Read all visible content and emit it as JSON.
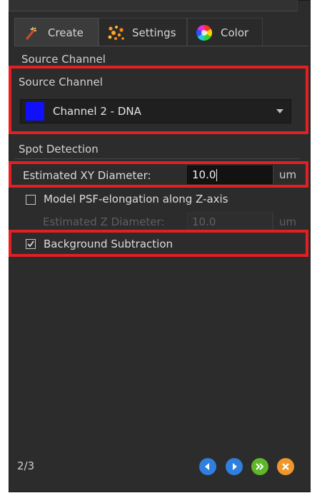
{
  "tabs": [
    {
      "label": "Create",
      "icon": "wand-icon"
    },
    {
      "label": "Settings",
      "icon": "dots-icon"
    },
    {
      "label": "Color",
      "icon": "color-wheel-icon"
    }
  ],
  "source_section": {
    "header": "Source Channel",
    "group_label": "Source Channel",
    "channel": {
      "value": "Channel 2 - DNA",
      "swatch_color": "#1010ff"
    }
  },
  "spot_section": {
    "header": "Spot Detection",
    "xy_diameter": {
      "label": "Estimated XY Diameter:",
      "value": "10.0",
      "unit": "um"
    },
    "model_psf": {
      "label": "Model PSF-elongation along Z-axis",
      "checked": false
    },
    "z_diameter": {
      "label": "Estimated Z Diameter:",
      "value": "10.0",
      "unit": "um"
    },
    "background_subtraction": {
      "label": "Background Subtraction",
      "checked": true
    }
  },
  "footer": {
    "page": "2/3",
    "nav_buttons": [
      "back-icon",
      "next-icon",
      "fast-forward-icon",
      "cancel-icon"
    ]
  },
  "colors": {
    "highlight": "#e41f22",
    "panel_bg": "#2c2c2c",
    "nav_blue": "#2f7fe0",
    "nav_green": "#5fb62a",
    "nav_orange": "#f0962a"
  }
}
